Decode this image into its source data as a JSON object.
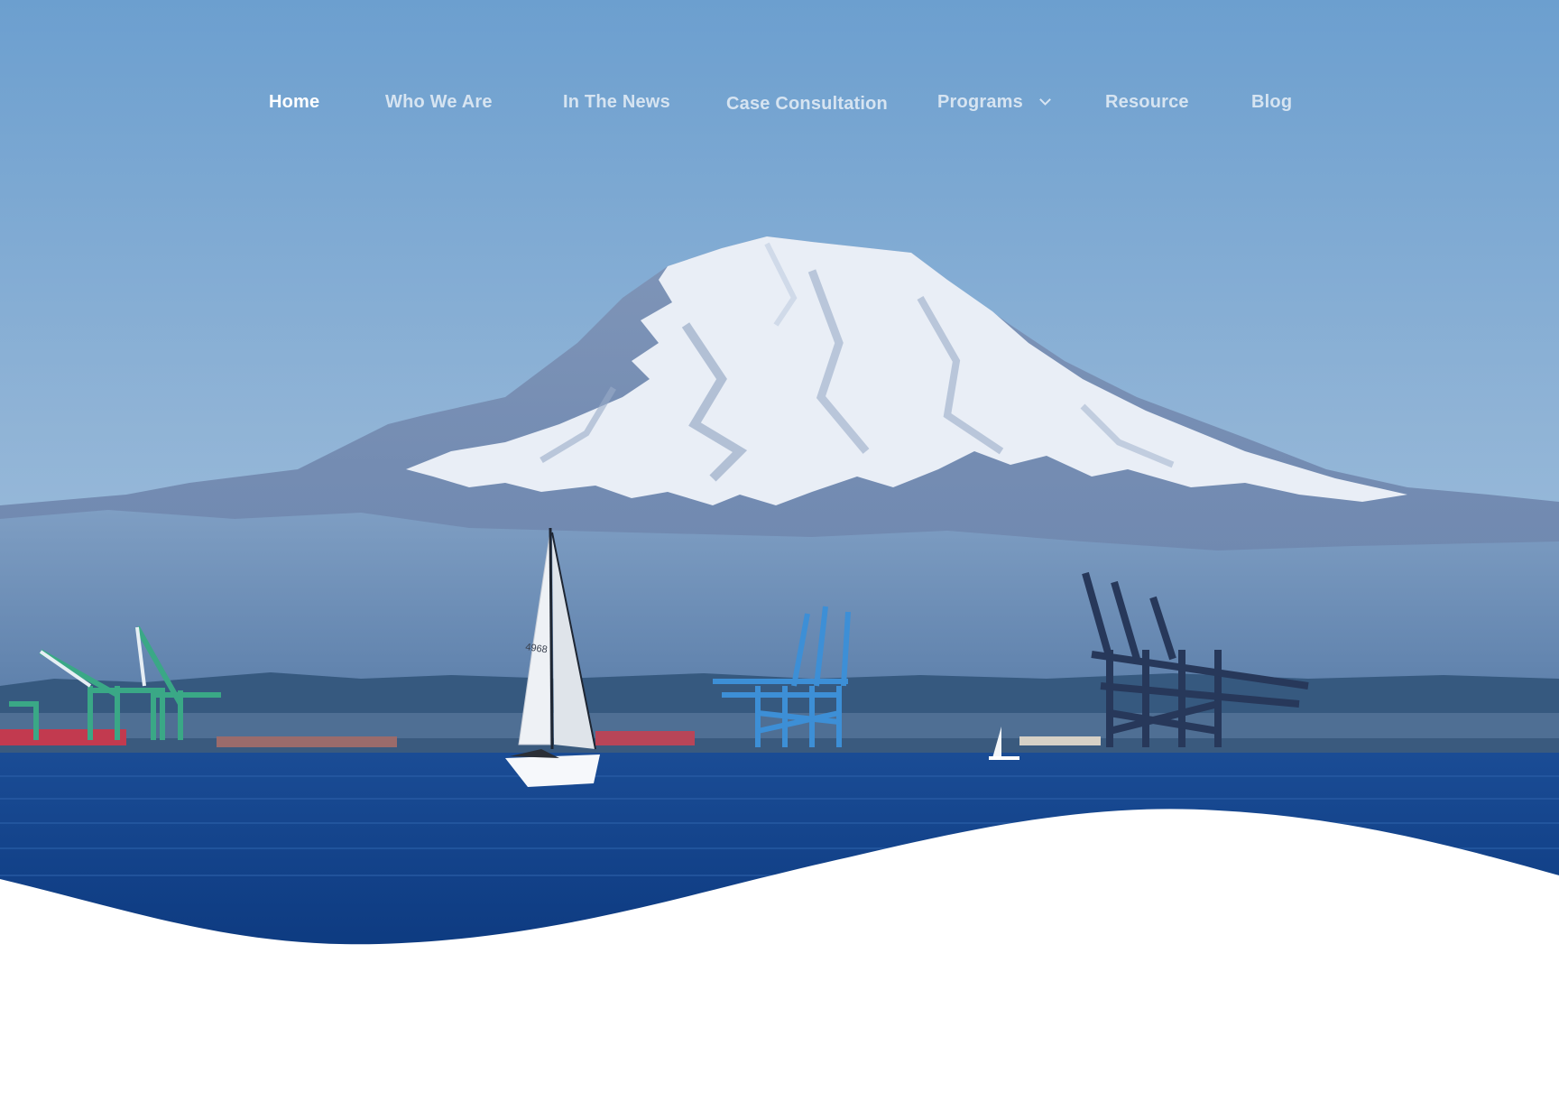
{
  "nav": {
    "items": [
      {
        "label": "Home",
        "active": true
      },
      {
        "label": "Who We Are",
        "active": false
      },
      {
        "label": "In The News",
        "active": false
      },
      {
        "label": "Case Consultation",
        "active": false
      },
      {
        "label": "Programs",
        "active": false,
        "has_dropdown": true,
        "icon": "chevron-down-icon"
      },
      {
        "label": "Resource",
        "active": false
      },
      {
        "label": "Blog",
        "active": false
      }
    ]
  },
  "hero": {
    "image_subject": "mountain-harbor-sailboat",
    "sailboat_number": "4968",
    "colors": {
      "sky_top": "#6fa1d0",
      "sky_bottom": "#9fbfdc",
      "water": "#103f8a",
      "snow": "#eef2f8",
      "wave": "#ffffff"
    }
  }
}
